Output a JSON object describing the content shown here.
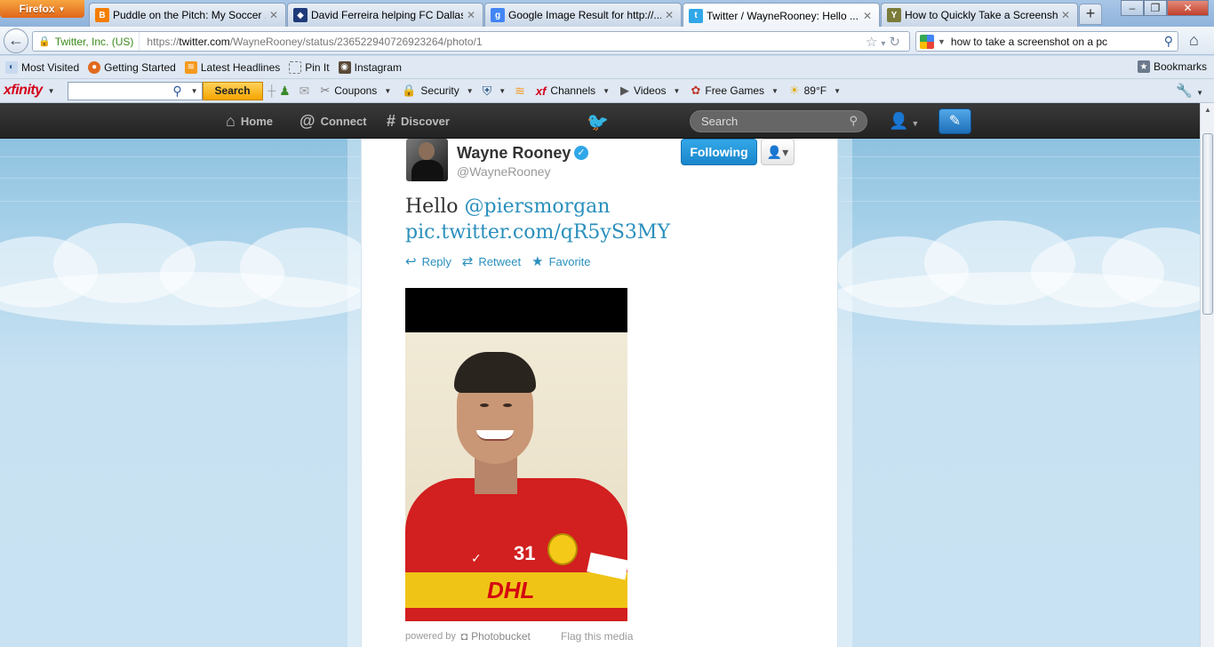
{
  "browser": {
    "app_button": "Firefox",
    "tabs": [
      {
        "title": "Puddle on the Pitch: My Soccer ...",
        "icon": "blogger-icon",
        "color": "#f57d00"
      },
      {
        "title": "David Ferreira helping FC Dallas ...",
        "icon": "fc-dallas-icon",
        "color": "#c8102e"
      },
      {
        "title": "Google Image Result for http://...",
        "icon": "google-icon",
        "color": "#4285f4"
      },
      {
        "title": "Twitter / WayneRooney: Hello ...",
        "icon": "twitter-icon",
        "color": "#2fa7e8"
      },
      {
        "title": "How to Quickly Take a Screensh...",
        "icon": "yahoo-icon",
        "color": "#7b7b3a"
      }
    ],
    "new_tab": "+",
    "identity": "Twitter, Inc. (US)",
    "url_prefix": "https://",
    "url_domain": "twitter.com",
    "url_path": "/WayneRooney/status/236522940726923264/photo/1",
    "search_query": "how to take a screenshot on a pc"
  },
  "bookmarks": {
    "items": [
      "Most Visited",
      "Getting Started",
      "Latest Headlines",
      "Pin It",
      "Instagram"
    ],
    "right": "Bookmarks"
  },
  "xfinity": {
    "logo": "xfinity",
    "search_value": "",
    "search_button": "Search",
    "items": [
      "Coupons",
      "Security",
      "Channels",
      "Videos",
      "Free Games",
      "89°F"
    ]
  },
  "twitter_nav": {
    "home": "Home",
    "connect": "Connect",
    "discover": "Discover",
    "search_placeholder": "Search"
  },
  "tweet": {
    "name": "Wayne Rooney",
    "handle": "@WayneRooney",
    "follow_button": "Following",
    "text_prefix": "Hello ",
    "mention": "@piersmorgan",
    "link": "pic.twitter.com/qR5yS3MY",
    "actions": [
      "Reply",
      "Retweet",
      "Favorite"
    ],
    "photo_shirt_number": "31",
    "photo_sponsor": "DHL",
    "powered_by": "powered by",
    "powered_brand": "Photobucket",
    "flag": "Flag this media"
  },
  "colors": {
    "twitter_blue": "#2fa7e8",
    "link_blue": "#2a8fbd",
    "topbar": "#2a2a2a"
  }
}
